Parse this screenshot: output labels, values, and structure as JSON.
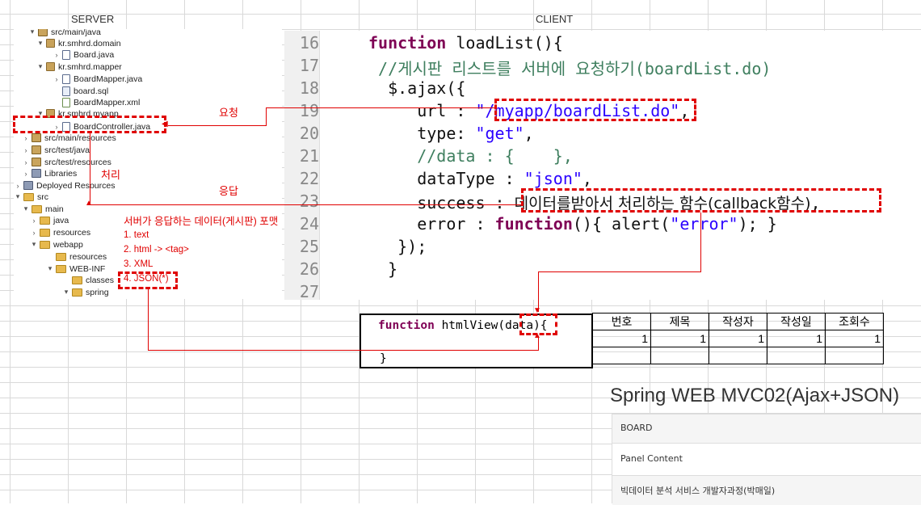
{
  "headers": {
    "server": "SERVER",
    "client": "CLIENT"
  },
  "tree": {
    "items": [
      {
        "label": "src/main/java",
        "arrow": "▾",
        "icon": "src",
        "name": "tree-item-src-main-java"
      },
      {
        "label": "kr.smhrd.domain",
        "arrow": "▾",
        "icon": "pkg",
        "name": "tree-item-domain-package"
      },
      {
        "label": "Board.java",
        "arrow": "›",
        "icon": "java",
        "name": "tree-item-board-java"
      },
      {
        "label": "kr.smhrd.mapper",
        "arrow": "▾",
        "icon": "pkg",
        "name": "tree-item-mapper-package"
      },
      {
        "label": "BoardMapper.java",
        "arrow": "›",
        "icon": "java",
        "name": "tree-item-boardmapper-java"
      },
      {
        "label": "board.sql",
        "arrow": "",
        "icon": "sql",
        "name": "tree-item-board-sql"
      },
      {
        "label": "BoardMapper.xml",
        "arrow": "",
        "icon": "xml",
        "name": "tree-item-boardmapper-xml"
      },
      {
        "label": "kr.smhrd.myapp",
        "arrow": "▾",
        "icon": "pkg",
        "name": "tree-item-myapp-package"
      },
      {
        "label": "BoardController.java",
        "arrow": "›",
        "icon": "java",
        "name": "tree-item-boardcontroller-java"
      },
      {
        "label": "src/main/resources",
        "arrow": "›",
        "icon": "src",
        "name": "tree-item-src-main-resources"
      },
      {
        "label": "src/test/java",
        "arrow": "›",
        "icon": "src",
        "name": "tree-item-src-test-java"
      },
      {
        "label": "src/test/resources",
        "arrow": "›",
        "icon": "src",
        "name": "tree-item-src-test-resources"
      },
      {
        "label": "Libraries",
        "arrow": "›",
        "icon": "lib",
        "name": "tree-item-libraries"
      },
      {
        "label": "Deployed Resources",
        "arrow": "›",
        "icon": "lib",
        "name": "tree-item-deployed-resources"
      },
      {
        "label": "src",
        "arrow": "▾",
        "icon": "fold",
        "name": "tree-item-src"
      },
      {
        "label": "main",
        "arrow": "▾",
        "icon": "fold",
        "name": "tree-item-main"
      },
      {
        "label": "java",
        "arrow": "›",
        "icon": "fold",
        "name": "tree-item-java"
      },
      {
        "label": "resources",
        "arrow": "›",
        "icon": "fold",
        "name": "tree-item-resources"
      },
      {
        "label": "webapp",
        "arrow": "▾",
        "icon": "fold",
        "name": "tree-item-webapp"
      },
      {
        "label": "resources",
        "arrow": "",
        "icon": "fold",
        "name": "tree-item-webapp-resources"
      },
      {
        "label": "WEB-INF",
        "arrow": "▾",
        "icon": "fold",
        "name": "tree-item-web-inf"
      },
      {
        "label": "classes",
        "arrow": "",
        "icon": "fold",
        "name": "tree-item-classes"
      },
      {
        "label": "spring",
        "arrow": "▾",
        "icon": "fold",
        "name": "tree-item-spring"
      }
    ]
  },
  "annotations": {
    "request": "요청",
    "process": "처리",
    "response": "응답",
    "format_title": "서버가 응답하는 데이터(게시판) 포맷",
    "formats": [
      "1. text",
      "2. html -> <tag>",
      "3. XML",
      "4. JSON(*)"
    ]
  },
  "code": {
    "line_numbers": [
      "16",
      "17",
      "18",
      "19",
      "20",
      "21",
      "22",
      "23",
      "24",
      "25",
      "26",
      "27"
    ],
    "l16_kw": "function",
    "l16_rest": " loadList(){",
    "l17": " //게시판 리스트를 서버에 요청하기(boardList.do)",
    "l18": "  $.ajax({",
    "l19_a": "     url : ",
    "l19_str": "\"/myapp/boardList.do\"",
    "l19_b": ",",
    "l20_a": "     type: ",
    "l20_str": "\"get\"",
    "l20_b": ",",
    "l21": "     //data : {    },",
    "l22_a": "     dataType : ",
    "l22_str": "\"json\"",
    "l22_b": ",",
    "l23_a": "     success : ",
    "l23_b": "데이터를받아서 처리하는 함수(callback함수)",
    "l23_c": ",",
    "l24_a": "     error : ",
    "l24_kw": "function",
    "l24_b": "(){ alert(",
    "l24_str": "\"error\"",
    "l24_c": "); }",
    "l25": "   });",
    "l26": "  }"
  },
  "htmlview": {
    "kw": "function",
    "name": " htmlView(",
    "param": "data",
    "close_paren": "){",
    "brace": "}"
  },
  "board_table": {
    "headers": [
      "번호",
      "제목",
      "작성자",
      "작성일",
      "조회수"
    ],
    "rows": [
      [
        "1",
        "1",
        "1",
        "1",
        "1"
      ],
      [
        "",
        "",
        "",
        "",
        ""
      ]
    ]
  },
  "panel": {
    "title": "Spring WEB MVC02(Ajax+JSON)",
    "heading": "BOARD",
    "content": "Panel Content",
    "footer": "빅데이터 분석 서비스 개발자과정(박매일)"
  },
  "colors": {
    "annotation": "#e00000",
    "keyword": "#7f0055",
    "string": "#2a00ff",
    "comment": "#3f7f5f"
  }
}
